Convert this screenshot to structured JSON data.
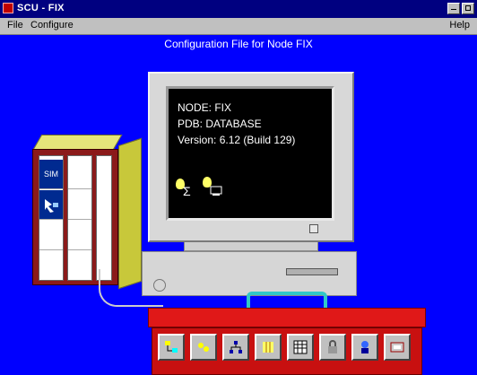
{
  "window": {
    "title": "SCU - FIX"
  },
  "menu": [
    {
      "label": "File"
    },
    {
      "label": "Configure"
    },
    {
      "label": "Help"
    }
  ],
  "content": {
    "heading": "Configuration File for Node FIX"
  },
  "rack": {
    "cards": [
      "SIM"
    ]
  },
  "screen": {
    "node": "NODE: FIX",
    "pdb": "PDB: DATABASE",
    "version": "Version: 6.12 (Build 129)"
  },
  "toolbox": {
    "tools": [
      {
        "icon": "network-config-icon"
      },
      {
        "icon": "scada-config-icon"
      },
      {
        "icon": "network-nodes-icon"
      },
      {
        "icon": "database-config-icon"
      },
      {
        "icon": "spreadsheet-icon"
      },
      {
        "icon": "security-lock-icon"
      },
      {
        "icon": "alarm-config-icon"
      },
      {
        "icon": "startup-config-icon"
      }
    ]
  },
  "colors": {
    "background": "#0000ff",
    "titlebar": "#000080",
    "toolbox": "#c81010",
    "rack": "#8b1a1a"
  }
}
